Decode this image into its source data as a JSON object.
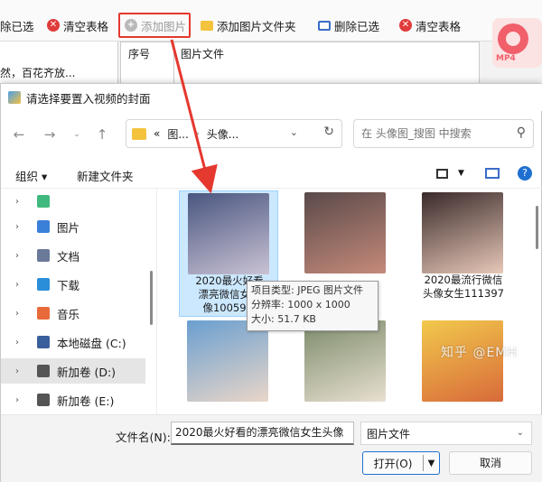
{
  "background_app": {
    "toolbar": {
      "select_all_label": "除已选",
      "clear_table_label": "清空表格",
      "add_image_label": "添加图片",
      "add_folder_label": "添加图片文件夹",
      "delete_selected_label": "删除已选",
      "clear_table2_label": "清空表格"
    },
    "left_panel_text": "然，百花齐放...",
    "table_headers": [
      "序号",
      "图片文件"
    ],
    "app_icon_text": "MP4"
  },
  "dialog": {
    "title": "请选择要置入视频的封面",
    "address": {
      "prefix": "«",
      "crumbs": [
        "图...",
        "头像..."
      ]
    },
    "search_placeholder": "在 头像图_搜图 中搜索",
    "commands": {
      "organize": "组织 ▾",
      "new_folder": "新建文件夹"
    },
    "nav_items": [
      {
        "label": "",
        "icon": "iam-app-icon",
        "color": "#3fb97d"
      },
      {
        "label": "图片",
        "icon": "pictures-icon",
        "color": "#3b7fd9"
      },
      {
        "label": "文档",
        "icon": "documents-icon",
        "color": "#6b7a99"
      },
      {
        "label": "下载",
        "icon": "downloads-icon",
        "color": "#2b8ed8"
      },
      {
        "label": "音乐",
        "icon": "music-icon",
        "color": "#e86a3a"
      },
      {
        "label": "本地磁盘 (C:)",
        "icon": "drive-c-icon",
        "color": "#3a5f9c"
      },
      {
        "label": "新加卷 (D:)",
        "icon": "drive-d-icon",
        "color": "#555555"
      },
      {
        "label": "新加卷 (E:)",
        "icon": "drive-e-icon",
        "color": "#555555"
      }
    ],
    "thumbnails": [
      {
        "name": "2020最火好看\n漂亮微信女生\n像10059...",
        "colors": [
          "#4a5680",
          "#c9c2d4"
        ]
      },
      {
        "name": "",
        "colors": [
          "#5a4a4a",
          "#c58a7a"
        ]
      },
      {
        "name": "2020最流行微信\n头像女生111397",
        "colors": [
          "#3a2a2a",
          "#e7c8b8"
        ]
      },
      {
        "name": "",
        "colors": [
          "#6a9fd0",
          "#e9d6c8"
        ]
      },
      {
        "name": "",
        "colors": [
          "#7b8a6a",
          "#e8e0d0"
        ]
      },
      {
        "name": "",
        "colors": [
          "#f2c94c",
          "#d86a3a"
        ]
      }
    ],
    "tooltip": {
      "type": "项目类型: JPEG 图片文件",
      "resolution": "分辨率: 1000 x 1000",
      "size": "大小: 51.7 KB"
    },
    "filename_label": "文件名(N):",
    "filename_value": "2020最火好看的漂亮微信女生头像",
    "filetype_value": "图片文件",
    "open_label": "打开(O)",
    "cancel_label": "取消"
  },
  "watermark": "知乎 @EMH",
  "colors": {
    "highlight_red": "#e5382f",
    "selection_blue": "#cce8ff",
    "accent_blue": "#1f6fd1"
  }
}
